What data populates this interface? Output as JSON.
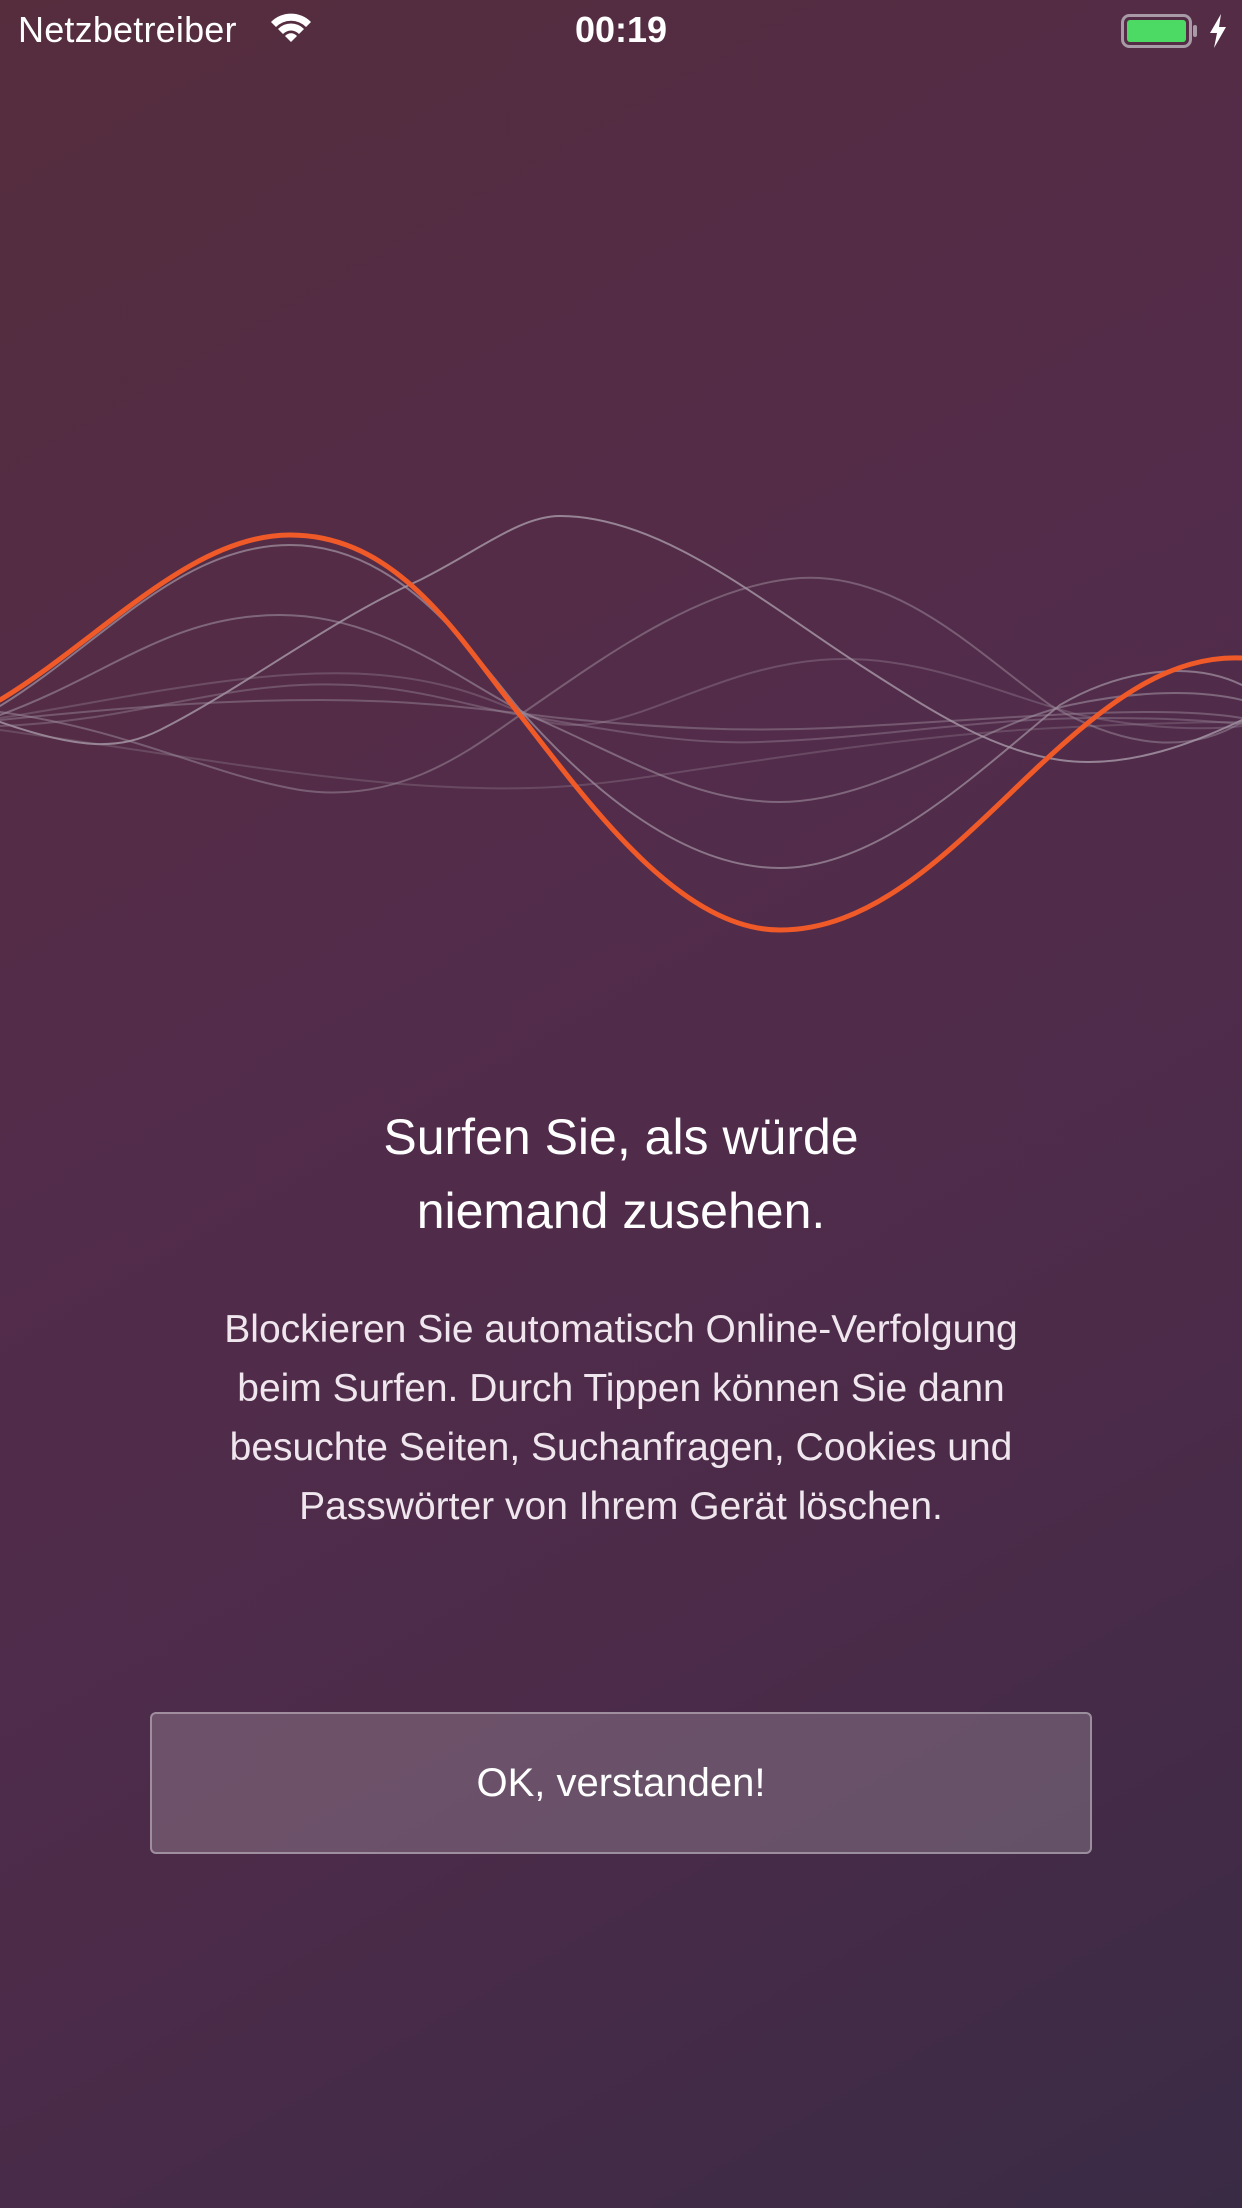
{
  "status_bar": {
    "carrier": "Netzbetreiber",
    "time": "00:19",
    "icons": [
      "wifi-icon",
      "battery-icon",
      "charging-icon"
    ]
  },
  "onboarding": {
    "title": "Surfen Sie, als würde\nniemand zusehen.",
    "description": "Blockieren Sie automatisch Online-Verfolgung\nbeim Surfen. Durch Tippen können Sie dann\nbesuchte Seiten, Suchanfragen, Cookies und\nPasswörter von Ihrem Gerät löschen.",
    "button_label": "OK, verstanden!"
  },
  "colors": {
    "background_start": "#552d3d",
    "background_end": "#3a2b45",
    "accent_wave": "#f05a28",
    "battery_fill": "#4cd964"
  }
}
